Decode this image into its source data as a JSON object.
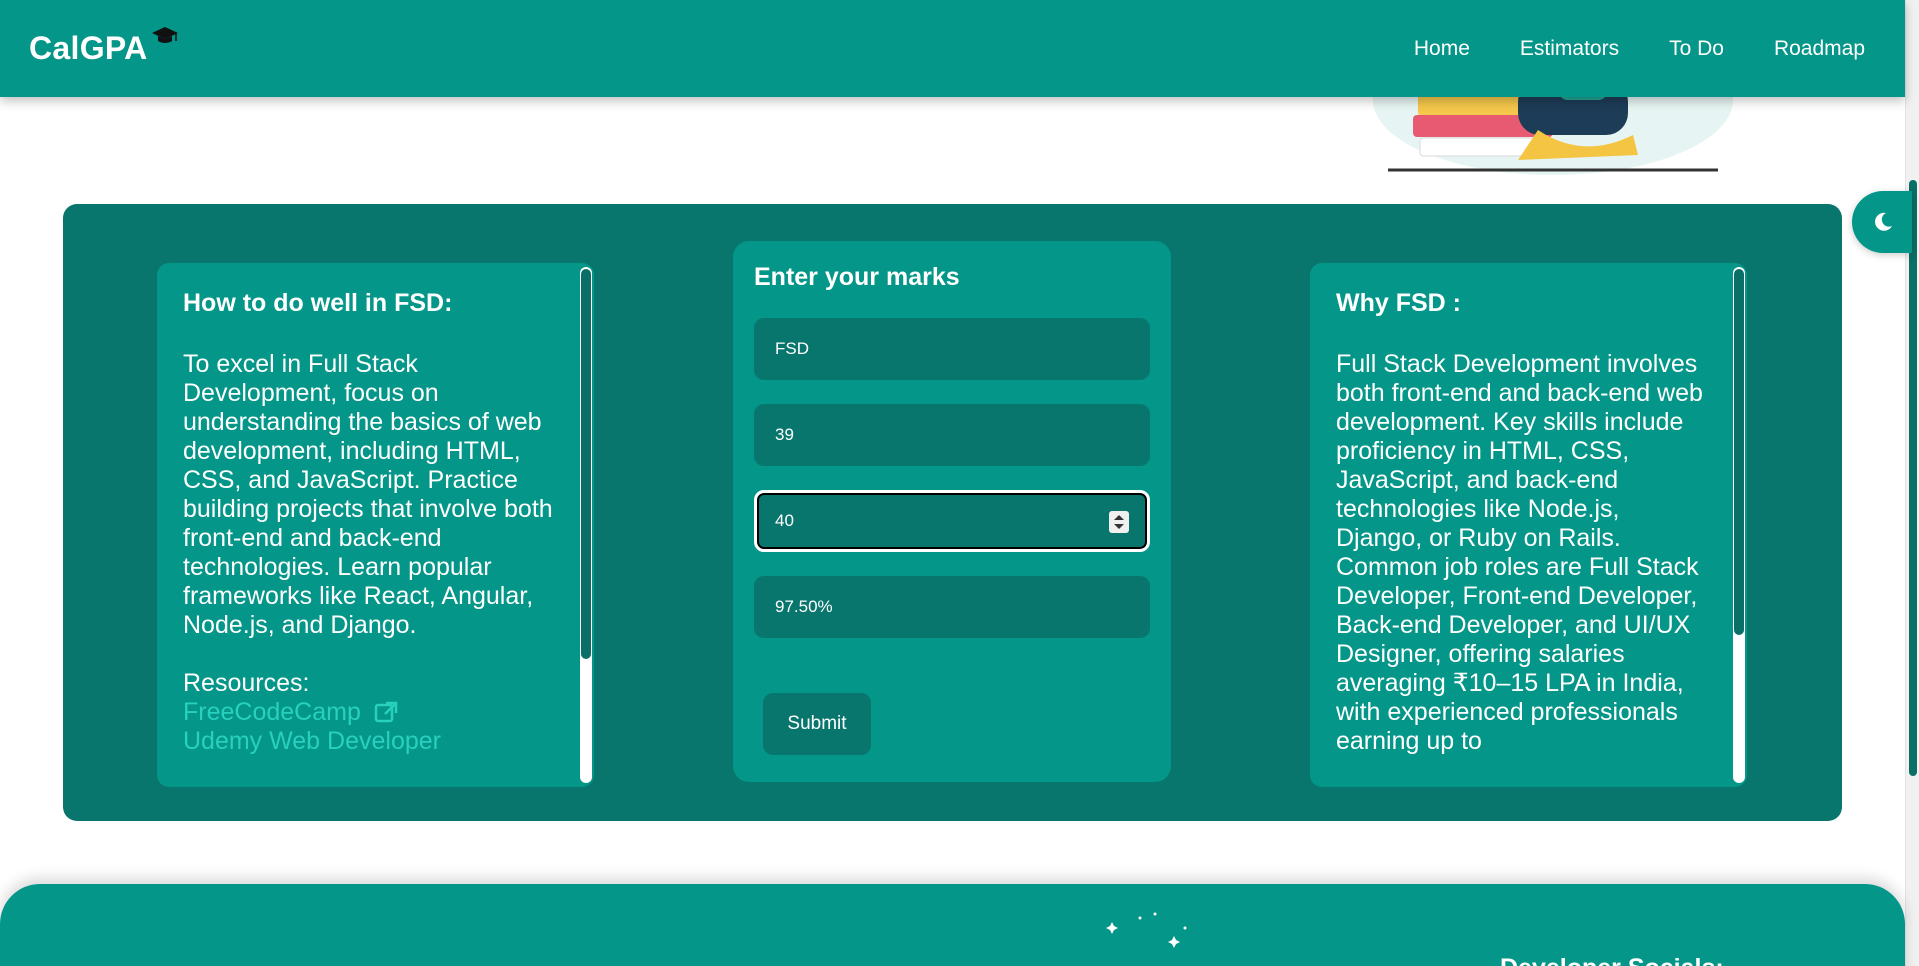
{
  "brand": {
    "name": "CalGPA"
  },
  "nav": {
    "links": [
      "Home",
      "Estimators",
      "To Do",
      "Roadmap"
    ]
  },
  "left_card": {
    "heading": "How to do well in FSD:",
    "body": "To excel in Full Stack Development, focus on understanding the basics of web development, including HTML, CSS, and JavaScript. Practice building projects that involve both front-end and back-end technologies. Learn popular frameworks like React, Angular, Node.js, and Django.",
    "resources_label": "Resources:",
    "resources": [
      "FreeCodeCamp",
      "Udemy Web Developer"
    ]
  },
  "form": {
    "title": "Enter your marks",
    "subject_value": "FSD",
    "obtained_value": "39",
    "total_value": "40",
    "percentage_value": "97.50%",
    "submit_label": "Submit"
  },
  "right_card": {
    "heading": "Why FSD :",
    "body": "Full Stack Development involves both front-end and back-end web development. Key skills include proficiency in HTML, CSS, JavaScript, and back-end technologies like Node.js, Django, or Ruby on Rails. Common job roles are Full Stack Developer, Front-end Developer, Back-end Developer, and UI/UX Designer, offering salaries averaging ₹10–15 LPA in India, with experienced professionals earning up to"
  },
  "footer": {
    "heading": "Developer Socials:"
  },
  "colors": {
    "primary": "#049688",
    "dark": "#08766d",
    "link": "#28d0be"
  },
  "icons": {
    "brand": "graduation-cap-icon",
    "theme": "moon-icon",
    "external": "external-link-icon"
  }
}
